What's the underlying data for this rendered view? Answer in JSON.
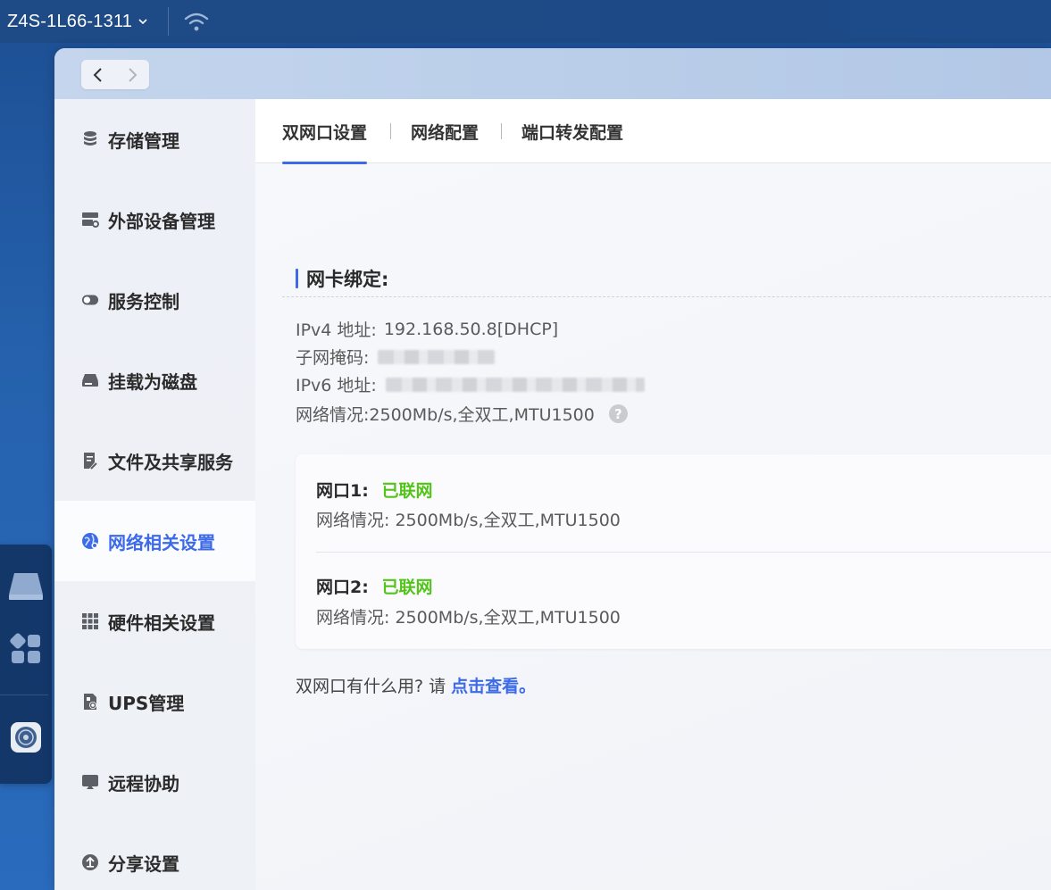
{
  "topbar": {
    "device_name": "Z4S-1L66-1311"
  },
  "sidebar": {
    "items": [
      {
        "label": "存储管理",
        "icon": "database-icon"
      },
      {
        "label": "外部设备管理",
        "icon": "external-device-icon"
      },
      {
        "label": "服务控制",
        "icon": "toggle-icon"
      },
      {
        "label": "挂载为磁盘",
        "icon": "disk-icon"
      },
      {
        "label": "文件及共享服务",
        "icon": "file-share-icon"
      },
      {
        "label": "网络相关设置",
        "icon": "globe-icon",
        "active": true
      },
      {
        "label": "硬件相关设置",
        "icon": "grid-icon"
      },
      {
        "label": "UPS管理",
        "icon": "ups-icon"
      },
      {
        "label": "远程协助",
        "icon": "remote-icon"
      },
      {
        "label": "分享设置",
        "icon": "upload-icon"
      }
    ]
  },
  "tabs": [
    {
      "label": "双网口设置",
      "active": true
    },
    {
      "label": "网络配置"
    },
    {
      "label": "端口转发配置"
    }
  ],
  "section": {
    "title": "网卡绑定:"
  },
  "info": {
    "ipv4_label": "IPv4 地址:",
    "ipv4_value": "192.168.50.8[DHCP]",
    "subnet_label": "子网掩码:",
    "ipv6_label": "IPv6 地址:",
    "network_status": "网络情况:2500Mb/s,全双工,MTU1500"
  },
  "ports": [
    {
      "label": "网口1:",
      "status": "已联网",
      "info": "网络情况: 2500Mb/s,全双工,MTU1500"
    },
    {
      "label": "网口2:",
      "status": "已联网",
      "info": "网络情况: 2500Mb/s,全双工,MTU1500"
    }
  ],
  "footer": {
    "text": "双网口有什么用? 请 ",
    "link": "点击查看。"
  },
  "colors": {
    "accent": "#3d6ae8",
    "status_ok": "#52c41a"
  }
}
